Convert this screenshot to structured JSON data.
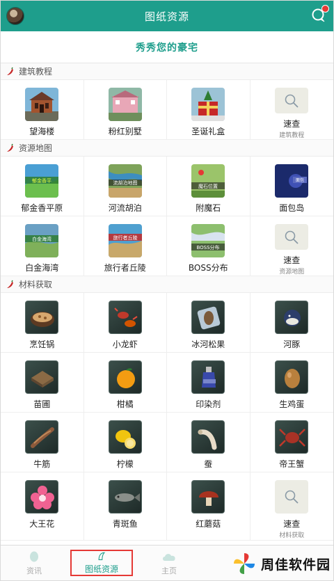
{
  "header": {
    "title": "图纸资源"
  },
  "banner": {
    "text": "秀秀您的豪宅"
  },
  "sections": [
    {
      "label": "建筑教程",
      "items": [
        {
          "name": "望海楼",
          "icon": "building-tower-thumbnail"
        },
        {
          "name": "粉红别墅",
          "icon": "pink-villa-thumbnail"
        },
        {
          "name": "圣诞礼盒",
          "icon": "christmas-box-thumbnail"
        },
        {
          "name": "速查",
          "sub": "建筑教程",
          "icon": "search-icon"
        }
      ]
    },
    {
      "label": "资源地图",
      "items": [
        {
          "name": "郁金香平原",
          "icon": "map-thumbnail",
          "overlay": "郁金香平"
        },
        {
          "name": "河流胡泊",
          "icon": "map-thumbnail",
          "overlay": "流胡泊地图"
        },
        {
          "name": "附魔石",
          "icon": "map-thumbnail",
          "overlay": "魔石位置"
        },
        {
          "name": "面包岛",
          "icon": "map-thumbnail",
          "overlay": "面包"
        },
        {
          "name": "白金海湾",
          "icon": "map-thumbnail",
          "overlay": "白金海湾"
        },
        {
          "name": "旅行者丘陵",
          "icon": "map-thumbnail",
          "overlay": "旅行者丘陵"
        },
        {
          "name": "BOSS分布",
          "icon": "map-thumbnail",
          "overlay": "BOSS分布"
        },
        {
          "name": "速查",
          "sub": "资源地图",
          "icon": "search-icon"
        }
      ]
    },
    {
      "label": "材料获取",
      "items": [
        {
          "name": "烹饪锅",
          "icon": "cooking-pot-icon"
        },
        {
          "name": "小龙虾",
          "icon": "crayfish-icon"
        },
        {
          "name": "冰河松果",
          "icon": "pinecone-icon"
        },
        {
          "name": "河豚",
          "icon": "pufferfish-icon"
        },
        {
          "name": "苗圃",
          "icon": "nursery-icon"
        },
        {
          "name": "柑橘",
          "icon": "orange-icon"
        },
        {
          "name": "印染剂",
          "icon": "dye-bottle-icon"
        },
        {
          "name": "生鸡蛋",
          "icon": "egg-icon"
        },
        {
          "name": "牛筋",
          "icon": "tendon-icon"
        },
        {
          "name": "柠檬",
          "icon": "lemon-icon"
        },
        {
          "name": "蚕",
          "icon": "silkworm-icon"
        },
        {
          "name": "帝王蟹",
          "icon": "king-crab-icon"
        },
        {
          "name": "大王花",
          "icon": "rafflesia-icon"
        },
        {
          "name": "青斑鱼",
          "icon": "grouper-icon"
        },
        {
          "name": "红蘑菇",
          "icon": "red-mushroom-icon"
        },
        {
          "name": "速查",
          "sub": "材料获取",
          "icon": "search-icon"
        }
      ]
    }
  ],
  "tabs": [
    {
      "label": "资讯",
      "active": false
    },
    {
      "label": "图纸资源",
      "active": true
    },
    {
      "label": "主页",
      "active": false
    }
  ],
  "watermark": {
    "text": "周佳软件园"
  },
  "colors": {
    "primary": "#1e9e8c",
    "highlight": "#e53935",
    "badge": "#e53935"
  }
}
